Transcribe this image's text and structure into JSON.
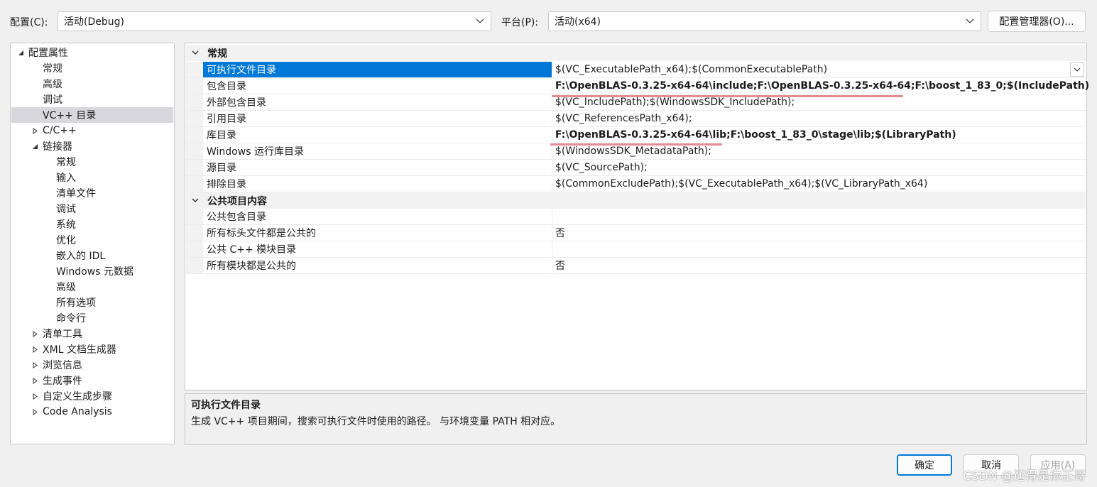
{
  "toolbar": {
    "config_label": "配置(C):",
    "config_value": "活动(Debug)",
    "platform_label": "平台(P):",
    "platform_value": "活动(x64)",
    "config_manager": "配置管理器(O)..."
  },
  "tree": {
    "root": "配置属性",
    "items": [
      "常规",
      "高级",
      "调试",
      "VC++ 目录",
      "C/C++",
      "链接器"
    ],
    "linker_children": [
      "常规",
      "输入",
      "清单文件",
      "调试",
      "系统",
      "优化",
      "嵌入的 IDL",
      "Windows 元数据",
      "高级",
      "所有选项",
      "命令行"
    ],
    "more": [
      "清单工具",
      "XML 文档生成器",
      "浏览信息",
      "生成事件",
      "自定义生成步骤",
      "Code Analysis"
    ]
  },
  "grid": {
    "cat1": "常规",
    "rows1": [
      {
        "name": "可执行文件目录",
        "value": "$(VC_ExecutablePath_x64);$(CommonExecutablePath)"
      },
      {
        "name": "包含目录",
        "value": "F:\\OpenBLAS-0.3.25-x64-64\\include;F:\\OpenBLAS-0.3.25-x64-64;F:\\boost_1_83_0;$(IncludePath)"
      },
      {
        "name": "外部包含目录",
        "value": "$(VC_IncludePath);$(WindowsSDK_IncludePath);"
      },
      {
        "name": "引用目录",
        "value": "$(VC_ReferencesPath_x64);"
      },
      {
        "name": "库目录",
        "value": "F:\\OpenBLAS-0.3.25-x64-64\\lib;F:\\boost_1_83_0\\stage\\lib;$(LibraryPath)"
      },
      {
        "name": "Windows 运行库目录",
        "value": "$(WindowsSDK_MetadataPath);"
      },
      {
        "name": "源目录",
        "value": "$(VC_SourcePath);"
      },
      {
        "name": "排除目录",
        "value": "$(CommonExcludePath);$(VC_ExecutablePath_x64);$(VC_LibraryPath_x64)"
      }
    ],
    "cat2": "公共项目内容",
    "rows2": [
      {
        "name": "公共包含目录",
        "value": ""
      },
      {
        "name": "所有标头文件都是公共的",
        "value": "否"
      },
      {
        "name": "公共 C++ 模块目录",
        "value": ""
      },
      {
        "name": "所有模块都是公共的",
        "value": "否"
      }
    ]
  },
  "description": {
    "title": "可执行文件目录",
    "text": "生成 VC++ 项目期间，搜索可执行文件时使用的路径。 与环境变量 PATH 相对应。"
  },
  "buttons": {
    "ok": "确定",
    "cancel": "取消",
    "apply": "应用(A)"
  },
  "watermark": "CSDN @还得是你正哥",
  "colors": {
    "selection": "#0078d7",
    "tree_selection": "#d7d7dd",
    "underline": "#e88a94"
  }
}
